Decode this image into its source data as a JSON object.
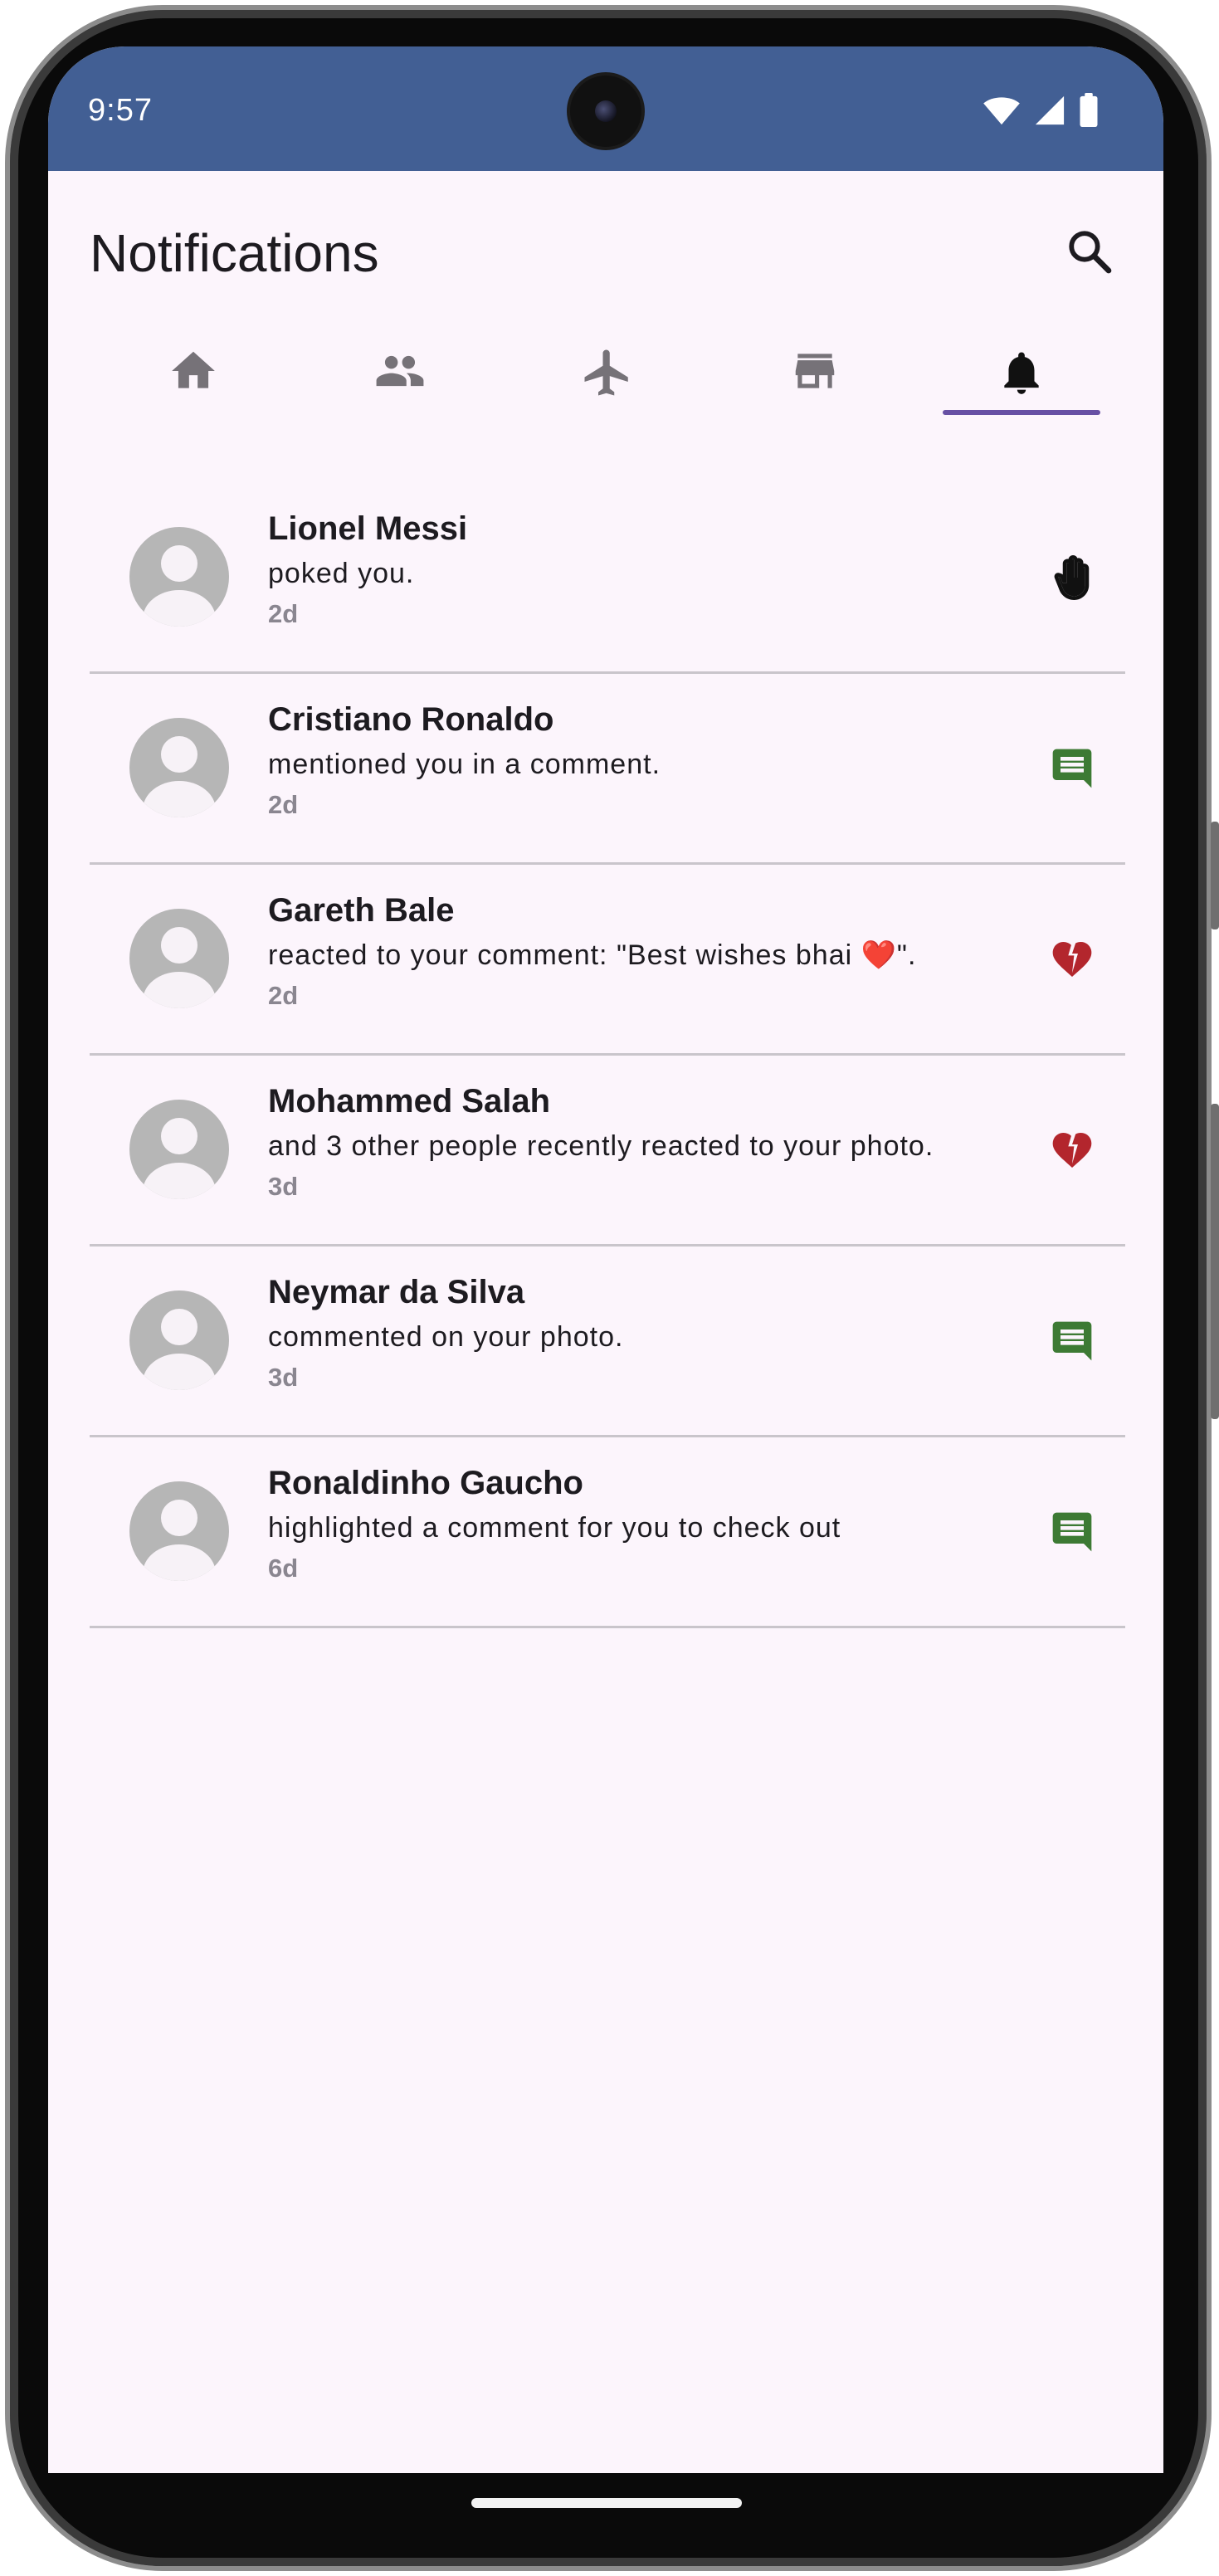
{
  "status_bar": {
    "time": "9:57",
    "background": "#425f94",
    "icons": [
      "wifi-icon",
      "signal-icon",
      "battery-icon"
    ]
  },
  "header": {
    "title": "Notifications",
    "search_icon": "search-icon"
  },
  "tabs": [
    {
      "icon": "home-icon",
      "active": false
    },
    {
      "icon": "people-icon",
      "active": false
    },
    {
      "icon": "airplane-icon",
      "active": false
    },
    {
      "icon": "store-icon",
      "active": false
    },
    {
      "icon": "bell-icon",
      "active": true
    }
  ],
  "accent_color": "#6750a4",
  "notifications": [
    {
      "name": "Lionel Messi",
      "message": "poked you.",
      "time": "2d",
      "icon": "hand-icon",
      "icon_color": "#111111"
    },
    {
      "name": "Cristiano Ronaldo",
      "message": "mentioned you in a comment.",
      "time": "2d",
      "icon": "comment-icon",
      "icon_color": "#3d7a34"
    },
    {
      "name": "Gareth Bale",
      "message": "reacted to your comment: \"Best wishes bhai ❤️\".",
      "time": "2d",
      "icon": "broken-heart-icon",
      "icon_color": "#b3262d"
    },
    {
      "name": "Mohammed Salah",
      "message": "and 3 other people recently reacted to your photo.",
      "time": "3d",
      "icon": "broken-heart-icon",
      "icon_color": "#b3262d"
    },
    {
      "name": "Neymar da Silva",
      "message": "commented on your photo.",
      "time": "3d",
      "icon": "comment-icon",
      "icon_color": "#3d7a34"
    },
    {
      "name": "Ronaldinho Gaucho",
      "message": "highlighted a comment for you to check out",
      "time": "6d",
      "icon": "comment-icon",
      "icon_color": "#3d7a34"
    }
  ]
}
